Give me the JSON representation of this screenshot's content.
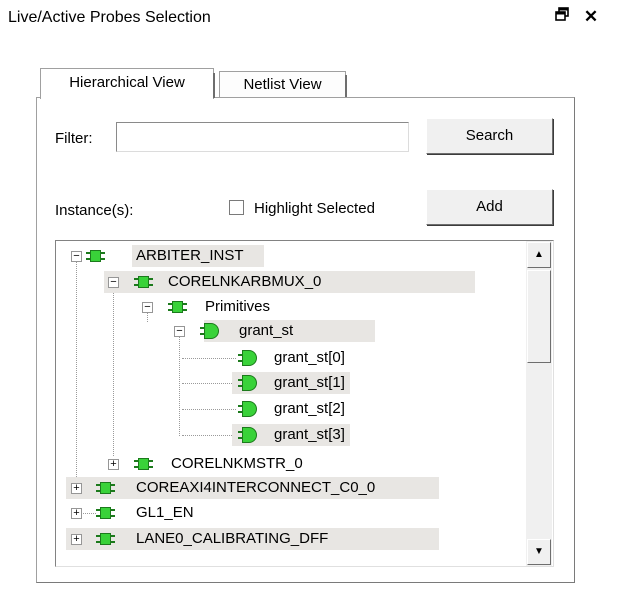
{
  "window": {
    "title": "Live/Active Probes Selection",
    "icons": [
      "restore-icon",
      "close-icon"
    ]
  },
  "tabs": [
    {
      "label": "Hierarchical View",
      "active": true
    },
    {
      "label": "Netlist View",
      "active": false
    }
  ],
  "filter": {
    "label": "Filter:",
    "value": "",
    "placeholder": ""
  },
  "search_button": "Search",
  "instances": {
    "label": "Instance(s):"
  },
  "highlight": {
    "label": "Highlight Selected",
    "checked": false
  },
  "add_button": "Add",
  "tree": [
    {
      "label": "ARBITER_INST",
      "type": "module",
      "expander": "minus"
    },
    {
      "label": "CORELNKARBMUX_0",
      "type": "module",
      "expander": "minus"
    },
    {
      "label": "Primitives",
      "type": "module",
      "expander": "minus"
    },
    {
      "label": "grant_st",
      "type": "dff",
      "expander": "minus"
    },
    {
      "label": "grant_st[0]",
      "type": "dff",
      "expander": "none"
    },
    {
      "label": "grant_st[1]",
      "type": "dff",
      "expander": "none"
    },
    {
      "label": "grant_st[2]",
      "type": "dff",
      "expander": "none"
    },
    {
      "label": "grant_st[3]",
      "type": "dff",
      "expander": "none"
    },
    {
      "label": "CORELNKMSTR_0",
      "type": "module",
      "expander": "plus"
    },
    {
      "label": "COREAXI4INTERCONNECT_C0_0",
      "type": "module",
      "expander": "plus"
    },
    {
      "label": "GL1_EN",
      "type": "module",
      "expander": "plus"
    },
    {
      "label": "LANE0_CALIBRATING_DFF",
      "type": "module",
      "expander": "plus"
    }
  ],
  "colors": {
    "icon_green": "#39d239",
    "row_highlight": "#e8e6e3"
  }
}
